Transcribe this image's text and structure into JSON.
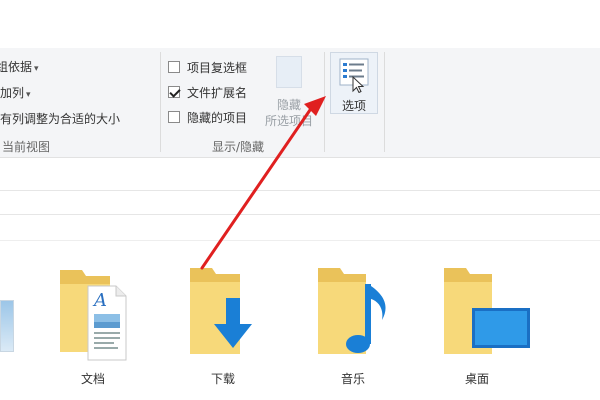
{
  "ribbon": {
    "group_by_label": "组依据",
    "add_column_label": "添加列",
    "fit_columns_label": "所有列调整为合适的大小",
    "current_view_group": "当前视图",
    "checkboxes": [
      {
        "label": "项目复选框",
        "checked": false
      },
      {
        "label": "文件扩展名",
        "checked": true
      },
      {
        "label": "隐藏的项目",
        "checked": false
      }
    ],
    "hide_selected_line1": "隐藏",
    "hide_selected_line2": "所选项目",
    "show_hide_group": "显示/隐藏",
    "options_label": "选项"
  },
  "folders": [
    {
      "name": "文档",
      "icon": "documents-folder-icon"
    },
    {
      "name": "下载",
      "icon": "downloads-folder-icon"
    },
    {
      "name": "音乐",
      "icon": "music-folder-icon"
    },
    {
      "name": "桌面",
      "icon": "desktop-folder-icon"
    }
  ],
  "colors": {
    "folder": "#f7d97a",
    "folder_back": "#eac25a",
    "accent_blue": "#1a7fd6",
    "annotation_arrow": "#e02020"
  }
}
